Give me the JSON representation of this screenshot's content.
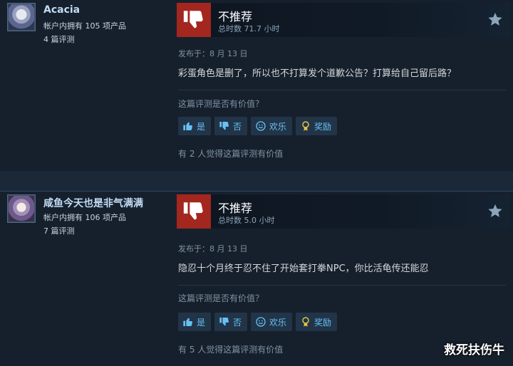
{
  "reviews": [
    {
      "author_name": "Acacia",
      "products_owned": "帐户内拥有 105 项产品",
      "review_count": "4 篇评测",
      "verdict": "不推荐",
      "hours": "总时数 71.7 小时",
      "posted": "发布于：8 月 13 日",
      "text": "彩蛋角色是删了，所以也不打算发个道歉公告？打算给自己留后路？",
      "helpful_question": "这篇评测是否有价值？",
      "buttons": {
        "yes": "是",
        "no": "否",
        "funny": "欢乐",
        "award": "奖励"
      },
      "helpful_count": "有 2 人觉得这篇评测有价值"
    },
    {
      "author_name": "咸鱼今天也是非气满满",
      "products_owned": "帐户内拥有 106 项产品",
      "review_count": "7 篇评测",
      "verdict": "不推荐",
      "hours": "总时数 5.0 小时",
      "posted": "发布于：8 月 13 日",
      "text": "隐忍十个月终于忍不住了开始套打拳NPC，你比活龟传还能忍",
      "helpful_question": "这篇评测是否有价值？",
      "buttons": {
        "yes": "是",
        "no": "否",
        "funny": "欢乐",
        "award": "奖励"
      },
      "helpful_count": "有 5 人觉得这篇评测有价值"
    }
  ],
  "watermark": "救死扶伤牛",
  "colors": {
    "page_bg": "#1b2838",
    "review_bg": "#16202d",
    "not_recommended": "#a3271f",
    "link_blue": "#67c1f5",
    "author_name": "#c1dbf4"
  },
  "icons": [
    "thumbs-down-icon",
    "star-icon",
    "thumbs-up-icon",
    "smiley-icon",
    "award-icon"
  ]
}
